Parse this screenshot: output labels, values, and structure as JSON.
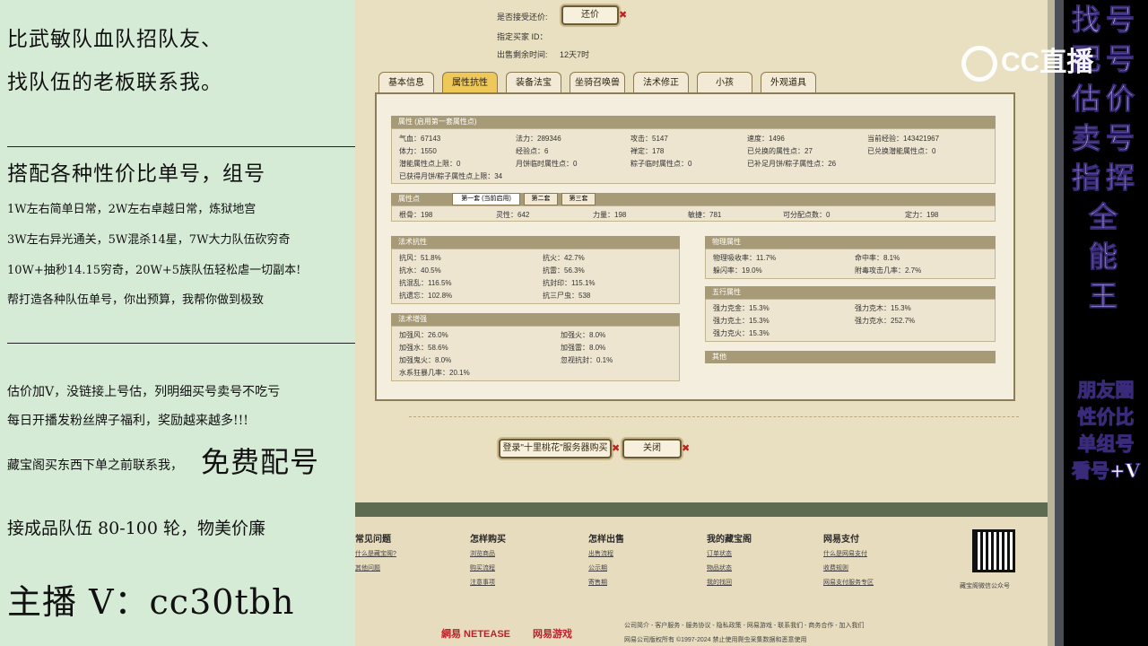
{
  "left_panel": {
    "headline": [
      "比武敏队血队招队友、",
      "找队伍的老板联系我。"
    ],
    "section2_title": "搭配各种性价比单号，组号",
    "section2_lines": [
      "1W左右简单日常，2W左右卓越日常，炼狱地宫",
      "3W左右异光通关，5W混杀14星，7W大力队伍砍穷奇",
      "10W+抽秒14.15穷奇，20W+5族队伍轻松虐一切副本!",
      "帮打造各种队伍单号，你出预算，我帮你做到极致"
    ],
    "section3_lines": [
      "估价加V，没链接上号估，列明细买号卖号不吃亏",
      "每日开播发粉丝牌子福利，奖励越来越多!!!"
    ],
    "section3_prefix": "藏宝阁买东西下单之前联系我，",
    "section3_highlight": "免费配号",
    "team_line": "接成品队伍 80-100 轮，物美价廉",
    "contact": "主播 V：cc30tbh"
  },
  "right_strip": {
    "big_chars": [
      "找号",
      "配号",
      "估价",
      "卖号",
      "指挥",
      "全",
      "能",
      "王"
    ],
    "small_lines": [
      "朋友圈",
      "性价比",
      "单组号",
      "看号+V"
    ]
  },
  "cc_logo": "CC直播",
  "game": {
    "accept_counter_label": "是否接受还价:",
    "counter_button": "还价",
    "buyer_id_label": "指定买家 ID：",
    "time_left_label": "出售剩余时间:",
    "time_left_value": "12天7时",
    "tabs": [
      "基本信息",
      "属性抗性",
      "装备法宝",
      "坐骑召唤兽",
      "法术修正",
      "小孩",
      "外观道具"
    ],
    "attr_section": {
      "title": "属性 (启用第一套属性点)",
      "rows": [
        [
          "气血：67143",
          "法力：289346",
          "攻击：5147",
          "速度：1496",
          "当前经验：143421967"
        ],
        [
          "体力：1550",
          "经验点：6",
          "禅定：178",
          "已兑换的属性点：27",
          "已兑换潜能属性点：0"
        ],
        [
          "潜能属性点上限：0",
          "月饼临时属性点：0",
          "粽子临时属性点：0",
          "已补足月饼/粽子属性点：26",
          ""
        ]
      ],
      "row4": "已获得月饼/粽子属性点上限：34"
    },
    "points_section": {
      "title": "属性点",
      "sub_tabs": [
        "第一套 (当前启用)",
        "第二套",
        "第三套"
      ],
      "values": [
        "根骨：198",
        "灵性：642",
        "力量：198",
        "敏捷：781",
        "可分配点数：0",
        "定力：198"
      ]
    },
    "resist_section": {
      "title": "法术抗性",
      "values": [
        "抗风：51.8%",
        "抗火：42.7%",
        "抗水：40.5%",
        "抗雷：56.3%",
        "抗混乱：116.5%",
        "抗封印：115.1%",
        "抗遗忘：102.8%",
        "抗三尸虫：538"
      ]
    },
    "boost_section": {
      "title": "法术增强",
      "values": [
        "加强风：26.0%",
        "加强火：8.0%",
        "加强水：58.6%",
        "加强雷：8.0%",
        "加强鬼火：8.0%",
        "忽视抗封：0.1%",
        "水系狂暴几率：20.1%"
      ]
    },
    "physical_section": {
      "title": "物理属性",
      "values": [
        "物理吸收率：11.7%",
        "命中率：8.1%",
        "躲闪率：19.0%",
        "附毒攻击几率：2.7%"
      ]
    },
    "element_section": {
      "title": "五行属性",
      "values": [
        "强力克金：15.3%",
        "强力克木：15.3%",
        "强力克土：15.3%",
        "强力克水：252.7%",
        "强力克火：15.3%"
      ]
    },
    "other_section": {
      "title": "其他"
    },
    "login_button": "登录\"十里桃花\"服务器购买",
    "close_button": "关闭",
    "footer": {
      "columns": [
        {
          "title": "常见问题",
          "links": [
            "什么是藏宝阁?",
            "其他问题"
          ]
        },
        {
          "title": "怎样购买",
          "links": [
            "浏览商品",
            "购买流程",
            "注意事项"
          ]
        },
        {
          "title": "怎样出售",
          "links": [
            "出售流程",
            "公示期",
            "寄售期"
          ]
        },
        {
          "title": "我的藏宝阁",
          "links": [
            "订单状态",
            "物品状态",
            "我的找回"
          ]
        },
        {
          "title": "网易支付",
          "links": [
            "什么是网易支付",
            "收费规则",
            "网易支付服务专区"
          ]
        }
      ],
      "qr_caption": "藏宝阁微信公众号",
      "bottom_links": "公司简介 - 客户服务 - 服务协议 - 隐私政策 - 网易游戏 - 联系我们 - 商务合作 - 加入我们",
      "copyright": "网易公司版权所有 ©1997-2024  禁止使用爬虫采集数据和恶意使用",
      "brand1": "網易 NETEASE",
      "brand2": "网易游戏"
    }
  }
}
